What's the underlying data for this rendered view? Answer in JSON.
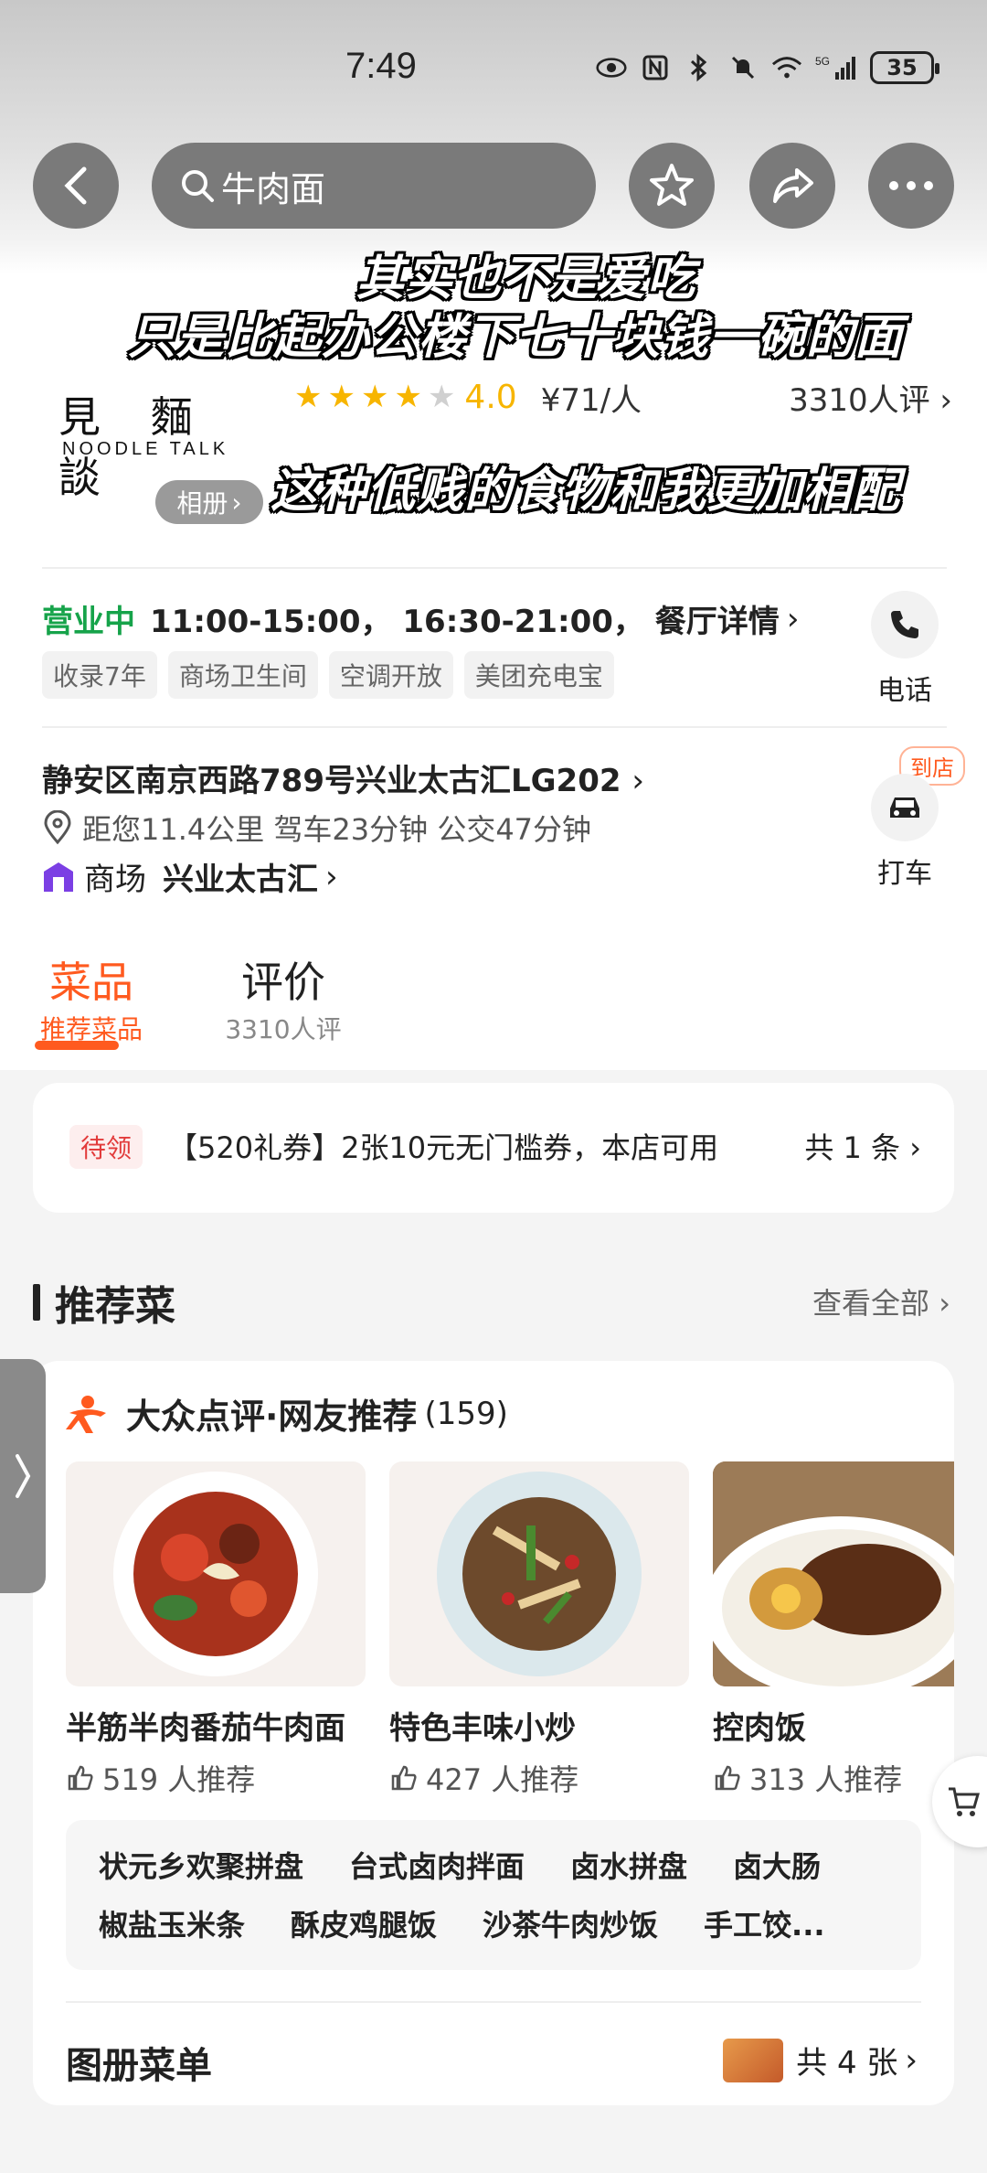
{
  "status_bar": {
    "time": "7:49",
    "network": "5G",
    "battery": "35"
  },
  "header": {
    "search_query": "牛肉面"
  },
  "subtitles": {
    "line1": "其实也不是爱吃",
    "line2": "只是比起办公楼下七十块钱一碗的面",
    "line3": "这种低贱的食物和我更加相配"
  },
  "shop": {
    "logo_cn": "見 麵 談",
    "logo_en": "NOODLE TALK",
    "album_label": "相册",
    "score": "4.0",
    "price": "¥71/人",
    "reviews": "3310人评",
    "open_status": "营业中",
    "hours": "11:00-15:00， 16:30-21:00， 餐厅详情",
    "tags": [
      "收录7年",
      "商场卫生间",
      "空调开放",
      "美团充电宝"
    ],
    "phone_label": "电话",
    "address": "静安区南京西路789号兴业太古汇LG202",
    "distance": "距您11.4公里 驾车23分钟 公交47分钟",
    "mall_prefix": "商场",
    "mall_name": "兴业太古汇",
    "to_store_badge": "到店",
    "taxi_label": "打车"
  },
  "tabs": [
    {
      "label": "菜品",
      "sub": "推荐菜品"
    },
    {
      "label": "评价",
      "sub": "3310人评"
    }
  ],
  "coupon": {
    "badge": "待领",
    "text": "【520礼券】2张10元无门槛券，本店可用",
    "count": "共 1 条"
  },
  "recommended": {
    "title": "推荐菜",
    "see_all": "查看全部",
    "source_title": "大众点评·网友推荐",
    "source_count": "(159)",
    "dishes": [
      {
        "name": "半筋半肉番茄牛肉面",
        "likes": "519 人推荐"
      },
      {
        "name": "特色丰味小炒",
        "likes": "427 人推荐"
      },
      {
        "name": "控肉饭",
        "likes": "313 人推荐"
      }
    ],
    "more_row1": [
      "状元乡欢聚拼盘",
      "台式卤肉拌面",
      "卤水拼盘",
      "卤大肠"
    ],
    "more_row2": [
      "椒盐玉米条",
      "酥皮鸡腿饭",
      "沙茶牛肉炒饭",
      "手工饺..."
    ],
    "menu_title": "图册菜单",
    "menu_count": "共 4 张"
  },
  "colors": {
    "accent": "#ff5a1f",
    "open_green": "#16a34a",
    "star": "#f7b500"
  }
}
